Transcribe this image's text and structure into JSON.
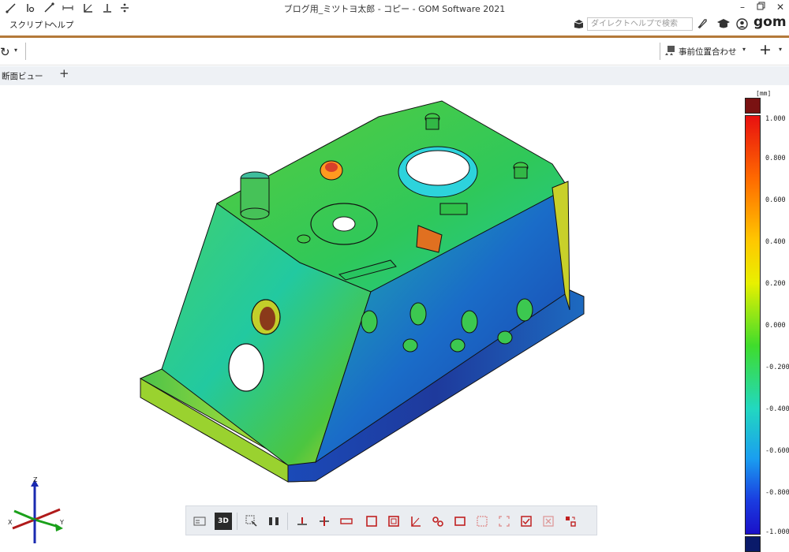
{
  "window": {
    "title": "ブログ用_ミツトヨ太郎 - コピー - GOM Software 2021"
  },
  "menu": {
    "items": [
      "スクリプト",
      "ヘルプ"
    ]
  },
  "help_search": {
    "placeholder": "ダイレクトヘルプで検索"
  },
  "brand": {
    "logo_text": "gom",
    "accent": "#b4793a"
  },
  "toolbar": {
    "alignment_label": "事前位置合わせ"
  },
  "view_tabs": {
    "active": "断面ビュー",
    "add_label": "+"
  },
  "legend": {
    "unit": "[mm]",
    "ticks": [
      "1.000",
      "0.800",
      "0.600",
      "0.400",
      "0.200",
      "0.000",
      "-0.200",
      "-0.400",
      "-0.600",
      "-0.800",
      "-1.000"
    ],
    "colors": {
      "over": "#7a1212",
      "under": "#0a1a6a"
    }
  },
  "axes": {
    "x": "X",
    "y": "Y",
    "z": "Z"
  },
  "bottom_toolbar": {
    "icons": [
      "view-info-icon",
      "3d-view-icon",
      "select-icon",
      "split-view-icon",
      "align-bottom-icon",
      "align-center-icon",
      "label-icon",
      "square-icon",
      "frame-icon",
      "angle-icon",
      "link-icon",
      "rectangle-icon",
      "grid-icon",
      "focus-icon",
      "check-icon",
      "cancel-icon",
      "arrange-icon"
    ]
  }
}
